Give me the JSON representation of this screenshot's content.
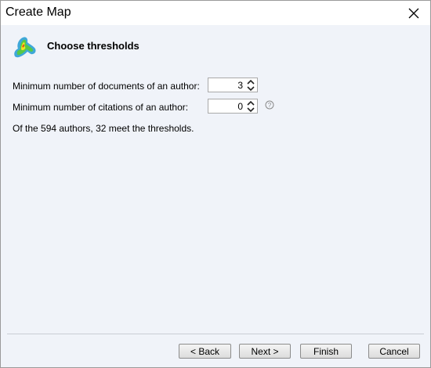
{
  "window": {
    "title": "Create Map"
  },
  "header": {
    "title": "Choose thresholds",
    "icon": "density-map-icon"
  },
  "form": {
    "min_documents_label": "Minimum number of documents of an author:",
    "min_documents_value": "3",
    "min_citations_label": "Minimum number of citations of an author:",
    "min_citations_value": "0"
  },
  "summary": "Of the 594 authors, 32 meet the thresholds.",
  "buttons": {
    "back": "< Back",
    "next": "Next >",
    "finish": "Finish",
    "cancel": "Cancel"
  }
}
